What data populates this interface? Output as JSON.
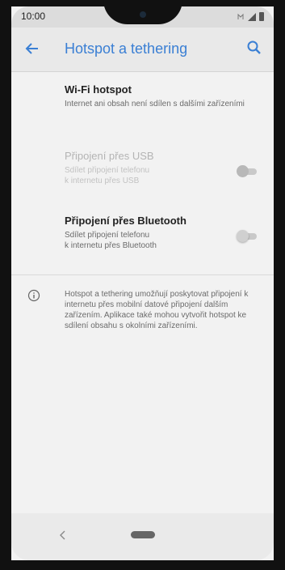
{
  "status_bar": {
    "time": "10:00"
  },
  "app_bar": {
    "title": "Hotspot a tethering",
    "back_icon": "arrow-left-icon",
    "search_icon": "search-icon"
  },
  "items": [
    {
      "title": "Wi-Fi hotspot",
      "subtitle": "Internet ani obsah není sdílen s dalšími zařízeními",
      "enabled": true
    },
    {
      "title": "Připojení přes USB",
      "subtitle_line1": "Sdílet připojení telefonu",
      "subtitle_line2": "k internetu přes USB",
      "enabled": false,
      "toggle_on": false
    },
    {
      "title": "Připojení přes Bluetooth",
      "subtitle_line1": "Sdílet připojení telefonu",
      "subtitle_line2": "k internetu přes Bluetooth",
      "enabled": true,
      "toggle_on": false
    }
  ],
  "info": {
    "icon": "info-icon",
    "text": "Hotspot a tethering umožňují poskytovat připojení k internetu přes mobilní datové připojení dalším zařízením. Aplikace také mohou vytvořit hotspot ke sdílení obsahu s okolními zařízeními."
  },
  "nav_bar": {
    "back_icon": "nav-back-icon",
    "home_icon": "home-pill-icon"
  },
  "colors": {
    "accent": "#3a7fd4",
    "background": "#f2f2f2",
    "app_bar": "#e9e9e9"
  }
}
